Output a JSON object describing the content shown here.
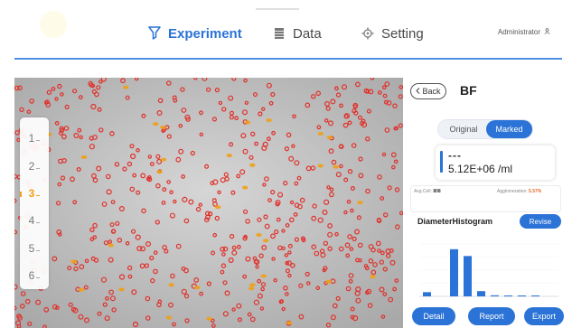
{
  "header": {
    "nav": [
      {
        "label": "Experiment",
        "icon": "funnel-icon",
        "active": true
      },
      {
        "label": "Data",
        "icon": "table-icon",
        "active": false
      },
      {
        "label": "Setting",
        "icon": "gear-icon",
        "active": false
      }
    ],
    "user": "Administrator"
  },
  "steps": [
    "1",
    "2",
    "3",
    "4",
    "5",
    "6"
  ],
  "active_step": "3",
  "panel": {
    "back_label": "Back",
    "title": "BF",
    "toggle": {
      "original": "Original",
      "marked": "Marked",
      "selected": "Marked"
    },
    "concentration_placeholder": "---",
    "concentration": "5.12E+06 /ml",
    "avg_cell_label": "Avg.Cell:",
    "avg_cell_value": "808",
    "agglomeration_label": "Agglomeration:",
    "agglomeration_value": "5.57%",
    "histogram_title": "DiameterHistogram",
    "revise_label": "Revise",
    "histogram_relative_heights": [
      0.08,
      0.0,
      0.9,
      0.77,
      0.1,
      0.02,
      0.01,
      0.01,
      0.01
    ]
  },
  "actions": {
    "detail": "Detail",
    "report": "Report",
    "export": "Export"
  },
  "colors": {
    "accent": "#2b73d6",
    "active_step": "#f0a013",
    "cell_marker": "#e0312b",
    "agglomerate_marker": "#f0a013"
  }
}
